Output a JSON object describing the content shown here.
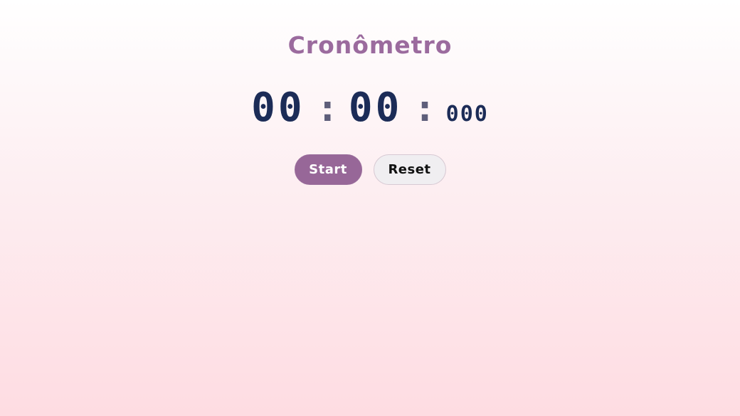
{
  "app": {
    "title": "Cronômetro"
  },
  "timer": {
    "minutes": "00",
    "separator_1": ":",
    "seconds": "00",
    "separator_2": ":",
    "milliseconds": "000"
  },
  "controls": {
    "start_label": "Start",
    "reset_label": "Reset"
  },
  "colors": {
    "accent": "#976798",
    "digits": "#1c2c57",
    "title": "#9b6b9e"
  }
}
